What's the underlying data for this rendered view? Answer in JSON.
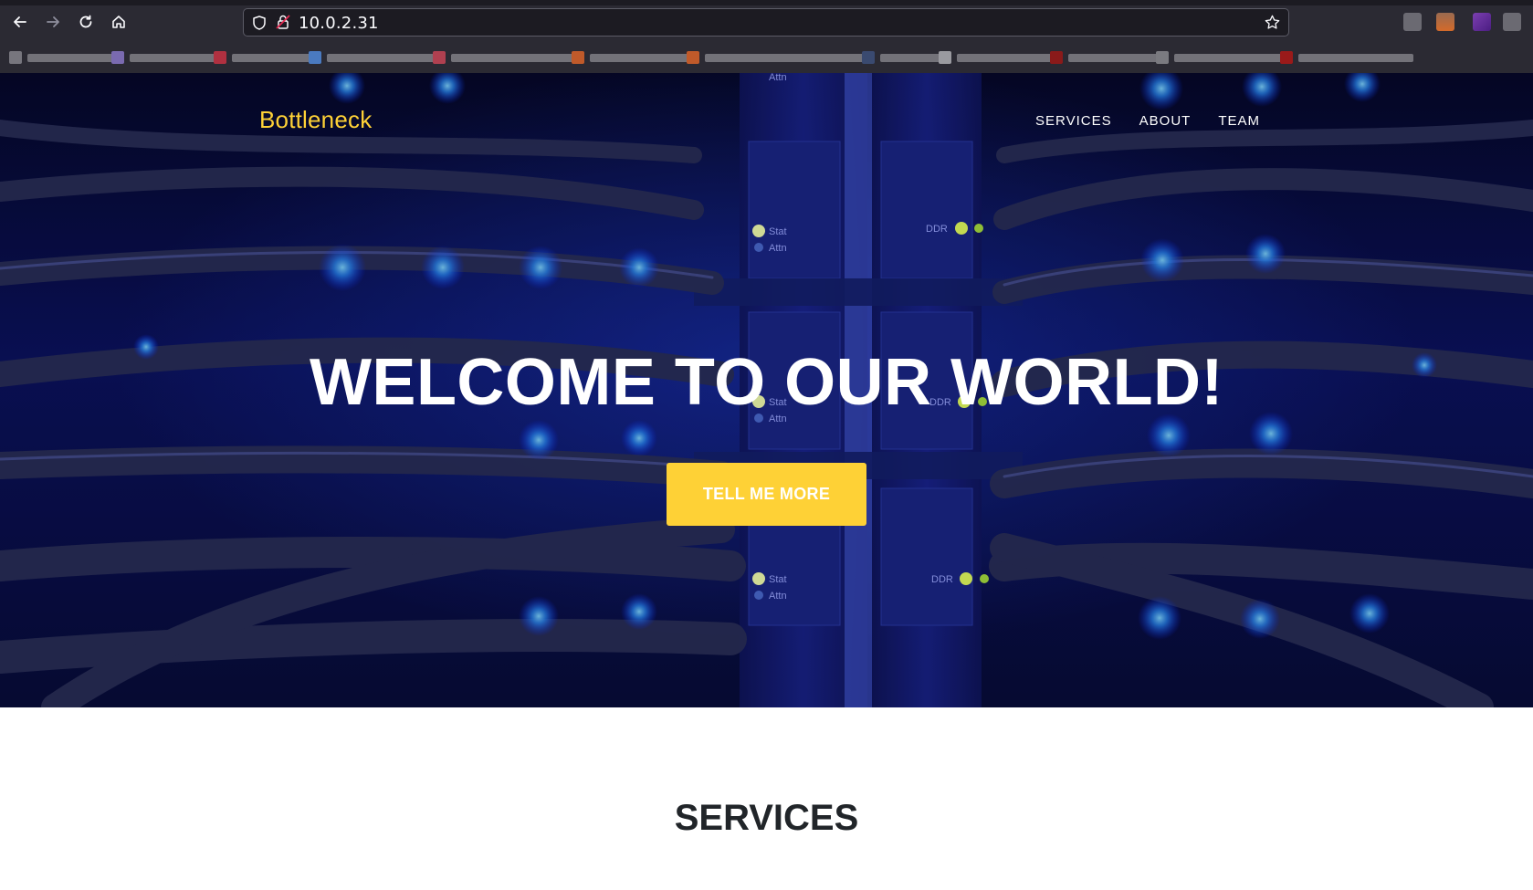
{
  "browser": {
    "url": "10.0.2.31"
  },
  "site": {
    "brand": "Bottleneck",
    "nav": [
      {
        "label": "SERVICES"
      },
      {
        "label": "ABOUT"
      },
      {
        "label": "TEAM"
      }
    ],
    "hero": {
      "title": "WELCOME TO OUR WORLD!",
      "cta_label": "TELL ME MORE",
      "server_labels": [
        "Attn",
        "Stat",
        "Attn",
        "DDR",
        "Stat",
        "Attn",
        "DDR",
        "Stat",
        "Attn",
        "DDR"
      ]
    },
    "services_heading": "SERVICES"
  },
  "colors": {
    "accent": "#fed136",
    "browser_chrome": "#2b2a33",
    "hero_blue": "#0b1260",
    "heading": "#212529"
  }
}
